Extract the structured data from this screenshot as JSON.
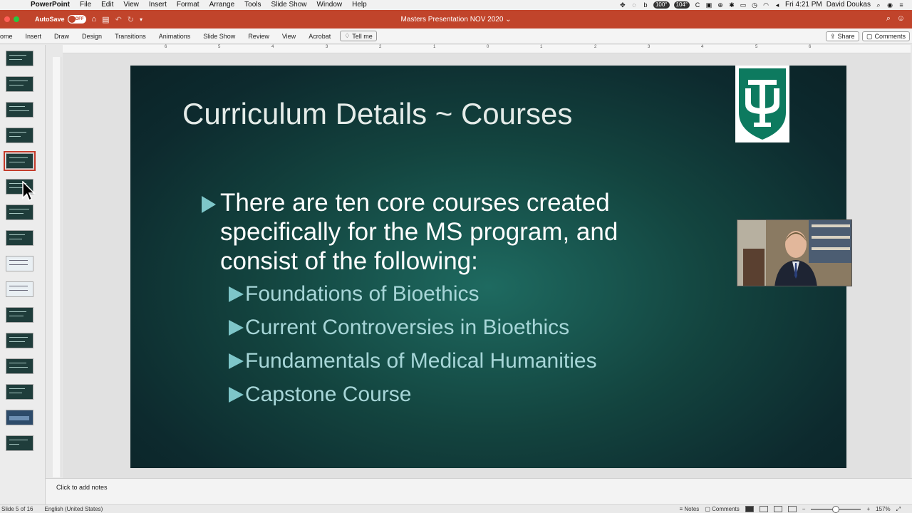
{
  "menubar": {
    "app": "PowerPoint",
    "items": [
      "File",
      "Edit",
      "View",
      "Insert",
      "Format",
      "Arrange",
      "Tools",
      "Slide Show",
      "Window",
      "Help"
    ],
    "status": {
      "battery_a": "100°",
      "battery_b": "104°",
      "clock": "Fri 4:21 PM",
      "user": "David Doukas"
    }
  },
  "titlebar": {
    "autosave_label": "AutoSave",
    "autosave_state": "OFF",
    "doc_title": "Masters Presentation NOV 2020 ⌄"
  },
  "ribbon": {
    "tabs": [
      "ome",
      "Insert",
      "Draw",
      "Design",
      "Transitions",
      "Animations",
      "Slide Show",
      "Review",
      "View",
      "Acrobat"
    ],
    "tell_me": "Tell me",
    "share": "Share",
    "comments": "Comments"
  },
  "ruler_ticks": [
    "6",
    "5",
    "4",
    "3",
    "2",
    "1",
    "0",
    "1",
    "2",
    "3",
    "4",
    "5",
    "6"
  ],
  "slide": {
    "title": "Curriculum Details ~ Courses",
    "main_bullet": "There are ten core courses created specifically for the MS program, and consist of the following:",
    "sub_bullets": [
      "Foundations of Bioethics",
      "Current Controversies in Bioethics",
      "Fundamentals of Medical Humanities",
      "Capstone Course"
    ],
    "logo_color": "#0d7a5f"
  },
  "notes": {
    "placeholder": "Click to add notes"
  },
  "statusbar": {
    "slide_info": "Slide 5 of 16",
    "language": "English (United States)",
    "notes": "Notes",
    "comments": "Comments",
    "zoom": "157%"
  },
  "colors": {
    "title_bar": "#c1442b",
    "slide_bg": "#13443f",
    "accent": "#7ec6c9"
  }
}
